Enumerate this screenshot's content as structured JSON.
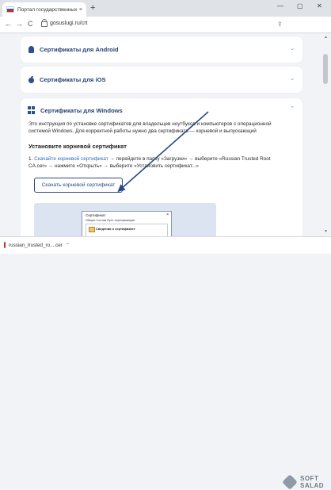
{
  "browser": {
    "tab_title": "Портал государственных услуг",
    "tab_close": "×",
    "new_tab": "+",
    "minimize": "—",
    "maximize": "▢",
    "close_window": "✕",
    "back": "←",
    "forward": "→",
    "reload": "C",
    "url": "gosuslugi.ru/crt",
    "share": "⇪"
  },
  "cards": [
    {
      "title": "Сертификаты для Android",
      "icon": "android-icon",
      "chevron": "⌄"
    },
    {
      "title": "Сертификаты для iOS",
      "icon": "apple-icon",
      "chevron": "⌄"
    },
    {
      "title": "Сертификаты для Windows",
      "icon": "windows-icon",
      "chevron": "⌃"
    }
  ],
  "windows": {
    "intro": "Это инструкция по установке сертификатов для владельцев ноутбуков и компьютеров с операционной системой Windows. Для корректной работы нужно два сертификата — корневой и выпускающий",
    "subhead": "Установите корневой сертификат",
    "step_num": "1.",
    "step_link": "Скачайте корневой сертификат",
    "step_text": " → перейдите в папку «Загрузки» → выберите «Russian Trusted Root CA.cer» → нажмите «Открыть» → выберите «Установить сертификат...»",
    "download_button": "Скачать корневой сертификат"
  },
  "dialog": {
    "title": "Сертификат",
    "close": "×",
    "tabs": "Общие   Состав   Путь сертификации",
    "info": "Сведения о сертификате"
  },
  "download_bar": {
    "file_name": "russian_trusted_ro....cer",
    "chevron": "⌃"
  },
  "watermark": {
    "line1": "SOFT",
    "line2": "SALAD"
  },
  "colors": {
    "accent": "#233f72",
    "link": "#2a6cc8",
    "arrow": "#2a4a7f"
  }
}
